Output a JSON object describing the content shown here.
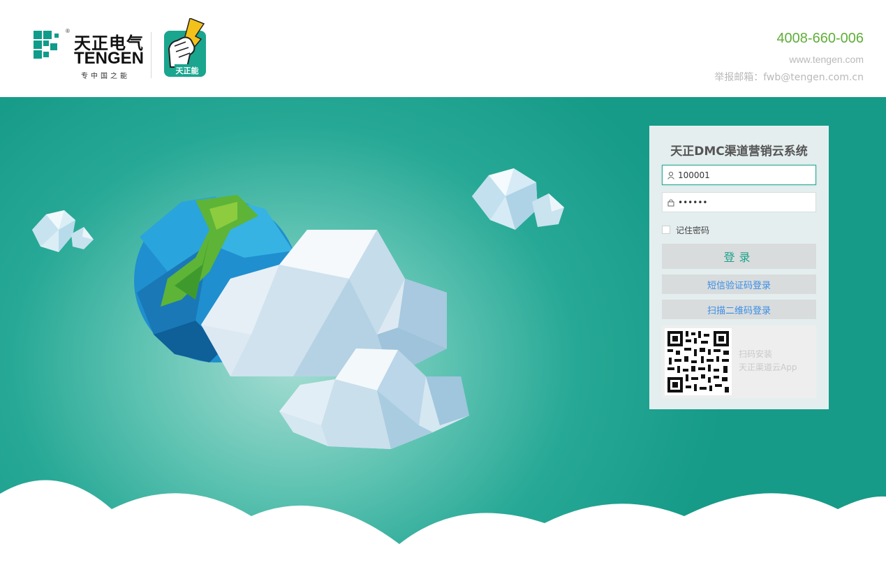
{
  "header": {
    "brand_cn": "天正电气",
    "brand_reg": "®",
    "brand_en": "TENGEN",
    "brand_slogan": "专中国之能",
    "mascot_label": "天正能",
    "phone": "4008-660-006",
    "website": "www.tengen.com",
    "report_email": "举报邮箱：fwb@tengen.com.cn"
  },
  "login": {
    "title": "天正DMC渠道营销云系统",
    "username_value": "100001",
    "password_value": "••••••",
    "remember_label": "记住密码",
    "login_button": "登录",
    "sms_login_button": "短信验证码登录",
    "qr_login_button": "扫描二维码登录",
    "qr_text_line1": "扫码安装",
    "qr_text_line2": "天正渠道云App"
  },
  "colors": {
    "brand_green": "#5fae39",
    "teal": "#1ea18c",
    "link_blue": "#3a8ee6",
    "logo_teal": "#0f9c8a"
  }
}
